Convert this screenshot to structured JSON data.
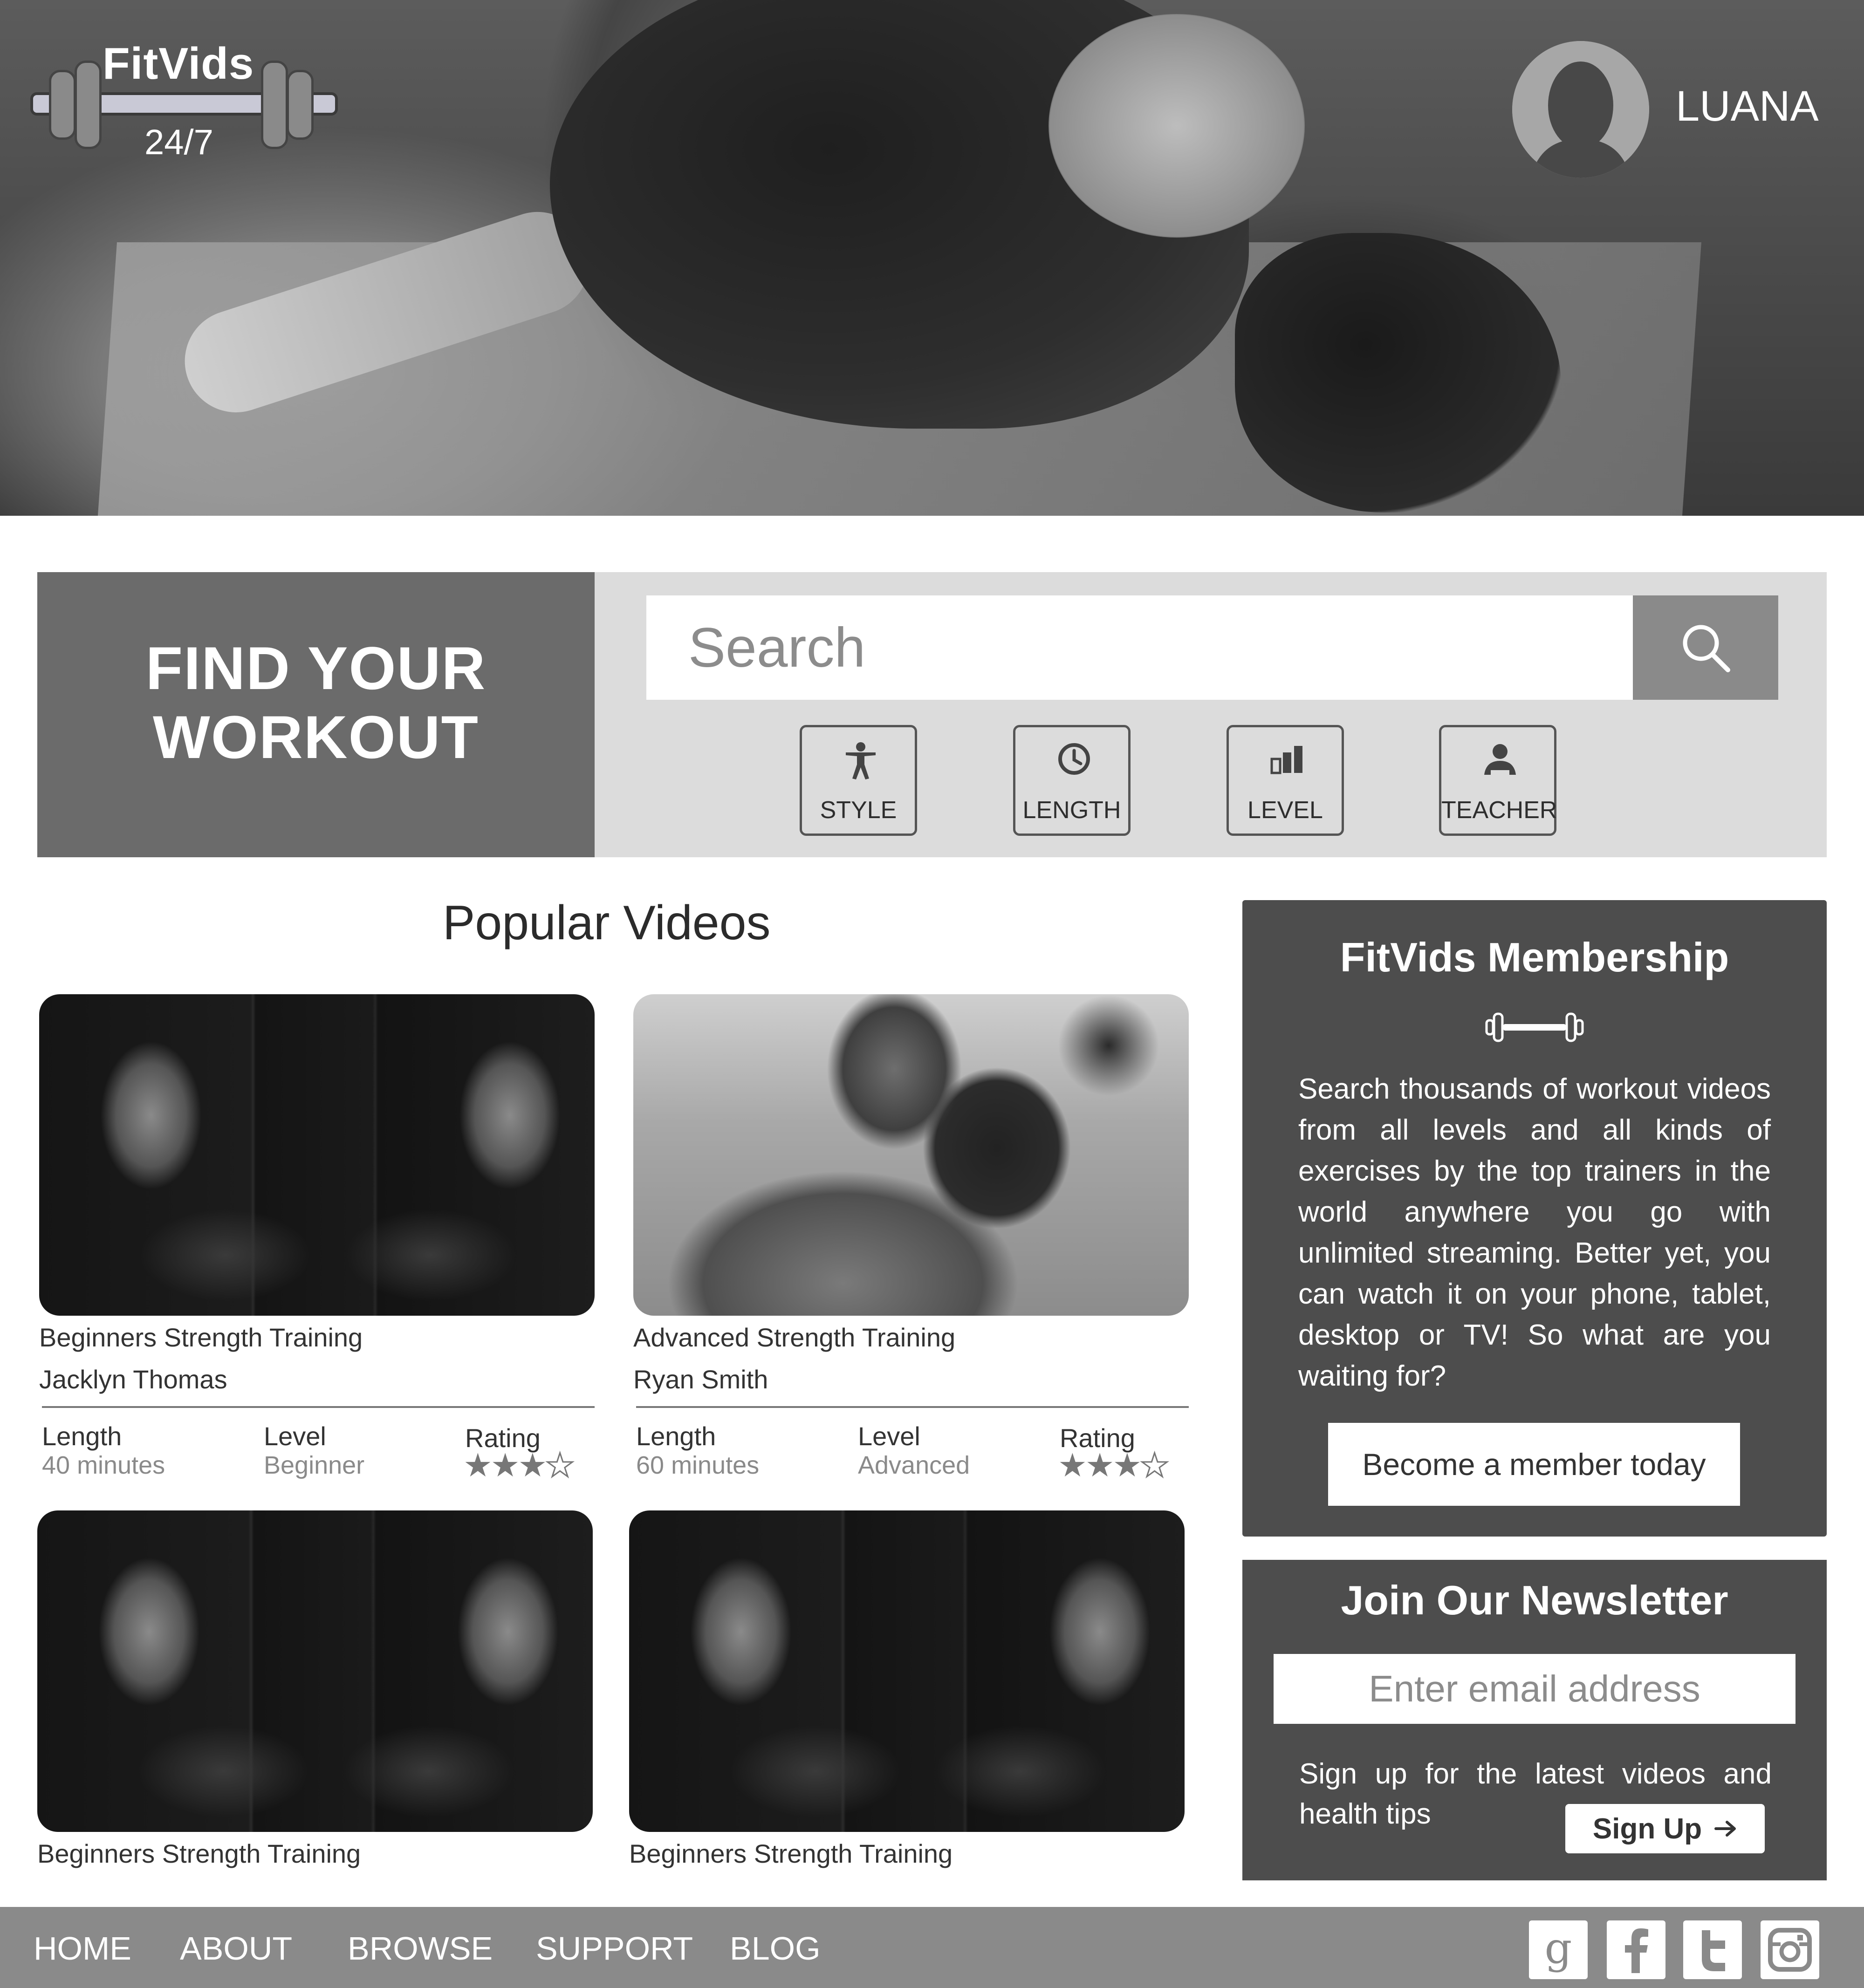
{
  "brand": {
    "name": "FitVids",
    "tagline": "24/7"
  },
  "user": {
    "name": "LUANA"
  },
  "search_panel": {
    "heading_line1": "FIND YOUR",
    "heading_line2": "WORKOUT",
    "search_placeholder": "Search",
    "filters": [
      {
        "label": "STYLE",
        "icon": "person-icon"
      },
      {
        "label": "LENGTH",
        "icon": "clock-icon"
      },
      {
        "label": "LEVEL",
        "icon": "levels-icon"
      },
      {
        "label": "TEACHER",
        "icon": "teacher-icon"
      }
    ]
  },
  "popular": {
    "title": "Popular Videos",
    "videos": [
      {
        "title": "Beginners Strength Training",
        "author": "Jacklyn Thomas",
        "length_label": "Length",
        "length": "40 minutes",
        "level_label": "Level",
        "level": "Beginner",
        "rating_label": "Rating",
        "rating": 3,
        "rating_max": 5
      },
      {
        "title": "Advanced Strength Training",
        "author": "Ryan Smith",
        "length_label": "Length",
        "length": "60 minutes",
        "level_label": "Level",
        "level": "Advanced",
        "rating_label": "Rating",
        "rating": 3,
        "rating_max": 5
      },
      {
        "title": "Beginners Strength Training"
      },
      {
        "title": "Beginners Strength Training"
      }
    ]
  },
  "membership": {
    "title": "FitVids Membership",
    "text": "Search thousands of workout videos from all levels and all kinds of exercises by the top trainers in the world anywhere you go with unlimited streaming. Better yet, you can watch it on your phone, tablet, desktop or TV! So what are you waiting for?",
    "button": "Become a member today"
  },
  "newsletter": {
    "title": "Join Our Newsletter",
    "email_placeholder": "Enter email address",
    "text_line1": "Sign up for the latest videos and",
    "text_line2": "health tips",
    "button": "Sign Up"
  },
  "footer": {
    "nav": [
      "HOME",
      "ABOUT",
      "BROWSE",
      "SUPPORT",
      "BLOG"
    ],
    "social": [
      "google-icon",
      "facebook-icon",
      "twitter-icon",
      "instagram-icon"
    ]
  },
  "colors": {
    "dark_panel": "#4d4d4d",
    "mid_gray": "#6b6b6b",
    "light_panel": "#dcdcdc",
    "footer": "#8a8a8a"
  }
}
